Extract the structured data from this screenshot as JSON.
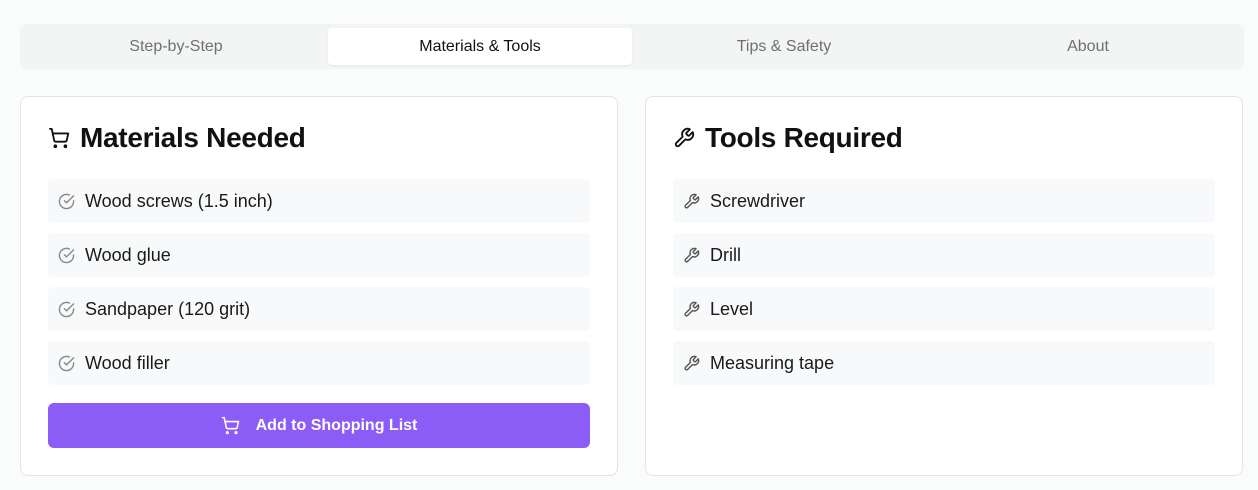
{
  "tabs": [
    {
      "label": "Step-by-Step",
      "active": false
    },
    {
      "label": "Materials & Tools",
      "active": true
    },
    {
      "label": "Tips & Safety",
      "active": false
    },
    {
      "label": "About",
      "active": false
    }
  ],
  "materials": {
    "title": "Materials Needed",
    "icon": "cart-icon",
    "items": [
      {
        "label": "Wood screws (1.5 inch)",
        "icon": "check-circle-icon"
      },
      {
        "label": "Wood glue",
        "icon": "check-circle-icon"
      },
      {
        "label": "Sandpaper (120 grit)",
        "icon": "check-circle-icon"
      },
      {
        "label": "Wood filler",
        "icon": "check-circle-icon"
      }
    ],
    "button_label": "Add to Shopping List",
    "button_icon": "cart-icon"
  },
  "tools": {
    "title": "Tools Required",
    "icon": "wrench-icon",
    "items": [
      {
        "label": "Screwdriver",
        "icon": "wrench-icon"
      },
      {
        "label": "Drill",
        "icon": "wrench-icon"
      },
      {
        "label": "Level",
        "icon": "wrench-icon"
      },
      {
        "label": "Measuring tape",
        "icon": "wrench-icon"
      }
    ]
  },
  "colors": {
    "accent": "#8b5cf6",
    "item_background": "#f8f9fa",
    "tab_bar_background": "#f3f4f4"
  }
}
